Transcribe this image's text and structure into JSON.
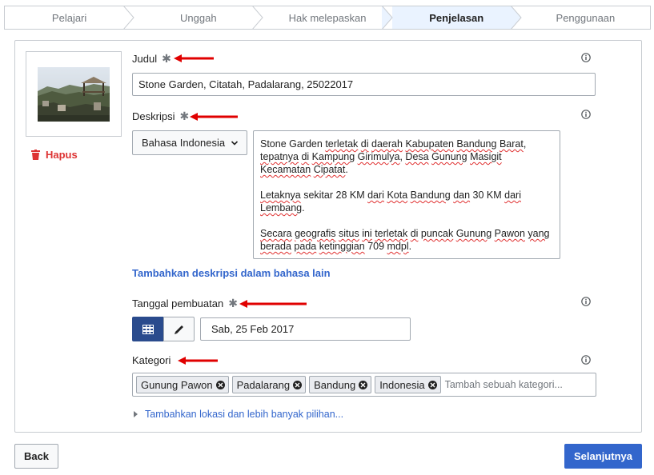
{
  "steps": [
    {
      "label": "Pelajari",
      "active": false
    },
    {
      "label": "Unggah",
      "active": false
    },
    {
      "label": "Hak melepaskan",
      "active": false
    },
    {
      "label": "Penjelasan",
      "active": true
    },
    {
      "label": "Penggunaan",
      "active": false
    }
  ],
  "file": {
    "delete_label": "Hapus"
  },
  "title_field": {
    "label": "Judul",
    "required_mark": "✱",
    "value": "Stone Garden, Citatah, Padalarang, 25022017"
  },
  "description_field": {
    "label": "Deskripsi",
    "required_mark": "✱",
    "language": "Bahasa Indonesia",
    "text": {
      "p1_w1": "Stone Garden ",
      "p1_w2": "terletak",
      "p1_w3": " ",
      "p1_w4": "di",
      "p1_w5": " ",
      "p1_w6": "daerah",
      "p1_w7": " ",
      "p1_w8": "Kabupaten",
      "p1_w9": " ",
      "p1_w10": "Bandung",
      "p1_w11": " ",
      "p1_w12": "Barat",
      "p1_w13": ", ",
      "p1_w14": "tepatnya",
      "p1_w15": " ",
      "p1_w16": "di",
      "p1_w17": " ",
      "p1_w18": "Kampung",
      "p1_w19": " ",
      "p1_w20": "Girimulya",
      "p1_w21": ", ",
      "p1_w22": "Desa",
      "p1_w23": " ",
      "p1_w24": "Gunung",
      "p1_w25": " ",
      "p1_w26": "Masigit",
      "p1_w27": " ",
      "p1_w28": "Kecamatan",
      "p1_w29": " ",
      "p1_w30": "Cipatat",
      "p1_w31": ".",
      "p2_w1": "Letaknya",
      "p2_w2": " sekitar 28 KM ",
      "p2_w3": "dari",
      "p2_w4": " ",
      "p2_w5": "Kota",
      "p2_w6": " ",
      "p2_w7": "Bandung",
      "p2_w8": " ",
      "p2_w9": "dan",
      "p2_w10": " 30 KM ",
      "p2_w11": "dari",
      "p2_w12": " ",
      "p2_w13": "Lembang",
      "p2_w14": ".",
      "p3_w1": "Secara",
      "p3_w2": " ",
      "p3_w3": "geografis",
      "p3_w4": " ",
      "p3_w5": "situs",
      "p3_w6": " ",
      "p3_w7": "ini",
      "p3_w8": " ",
      "p3_w9": "terletak",
      "p3_w10": " ",
      "p3_w11": "di",
      "p3_w12": " ",
      "p3_w13": "puncak",
      "p3_w14": " ",
      "p3_w15": "Gunung",
      "p3_w16": " ",
      "p3_w17": "Pawon",
      "p3_w18": " ",
      "p3_w19": "yang",
      "p3_w20": " ",
      "p3_w21": "berada",
      "p3_w22": " ",
      "p3_w23": "pada",
      "p3_w24": " ",
      "p3_w25": "ketinggian",
      "p3_w26": " 709 ",
      "p3_w27": "mdpl",
      "p3_w28": "."
    },
    "add_language_link": "Tambahkan deskripsi dalam bahasa lain"
  },
  "date_field": {
    "label": "Tanggal pembuatan",
    "required_mark": "✱",
    "value": "Sab, 25 Feb 2017"
  },
  "category_field": {
    "label": "Kategori",
    "tags": [
      "Gunung Pawon",
      "Padalarang",
      "Bandung",
      "Indonesia"
    ],
    "placeholder": "Tambah sebuah kategori..."
  },
  "more_options_link": "Tambahkan lokasi dan lebih banyak pilihan...",
  "buttons": {
    "back": "Back",
    "next": "Selanjutnya"
  },
  "icons": {
    "info": "info-icon",
    "delete": "trash-icon",
    "calendar": "calendar-icon",
    "pencil": "pencil-icon",
    "chevron": "chevron-down-icon",
    "remove": "remove-circle-icon",
    "expand": "triangle-right-icon"
  },
  "colors": {
    "accent": "#3366cc",
    "active_step": "#eaf3ff",
    "delete_red": "#d33333",
    "annotation_red": "#e00000",
    "calendar_btn": "#2a4b8d"
  }
}
